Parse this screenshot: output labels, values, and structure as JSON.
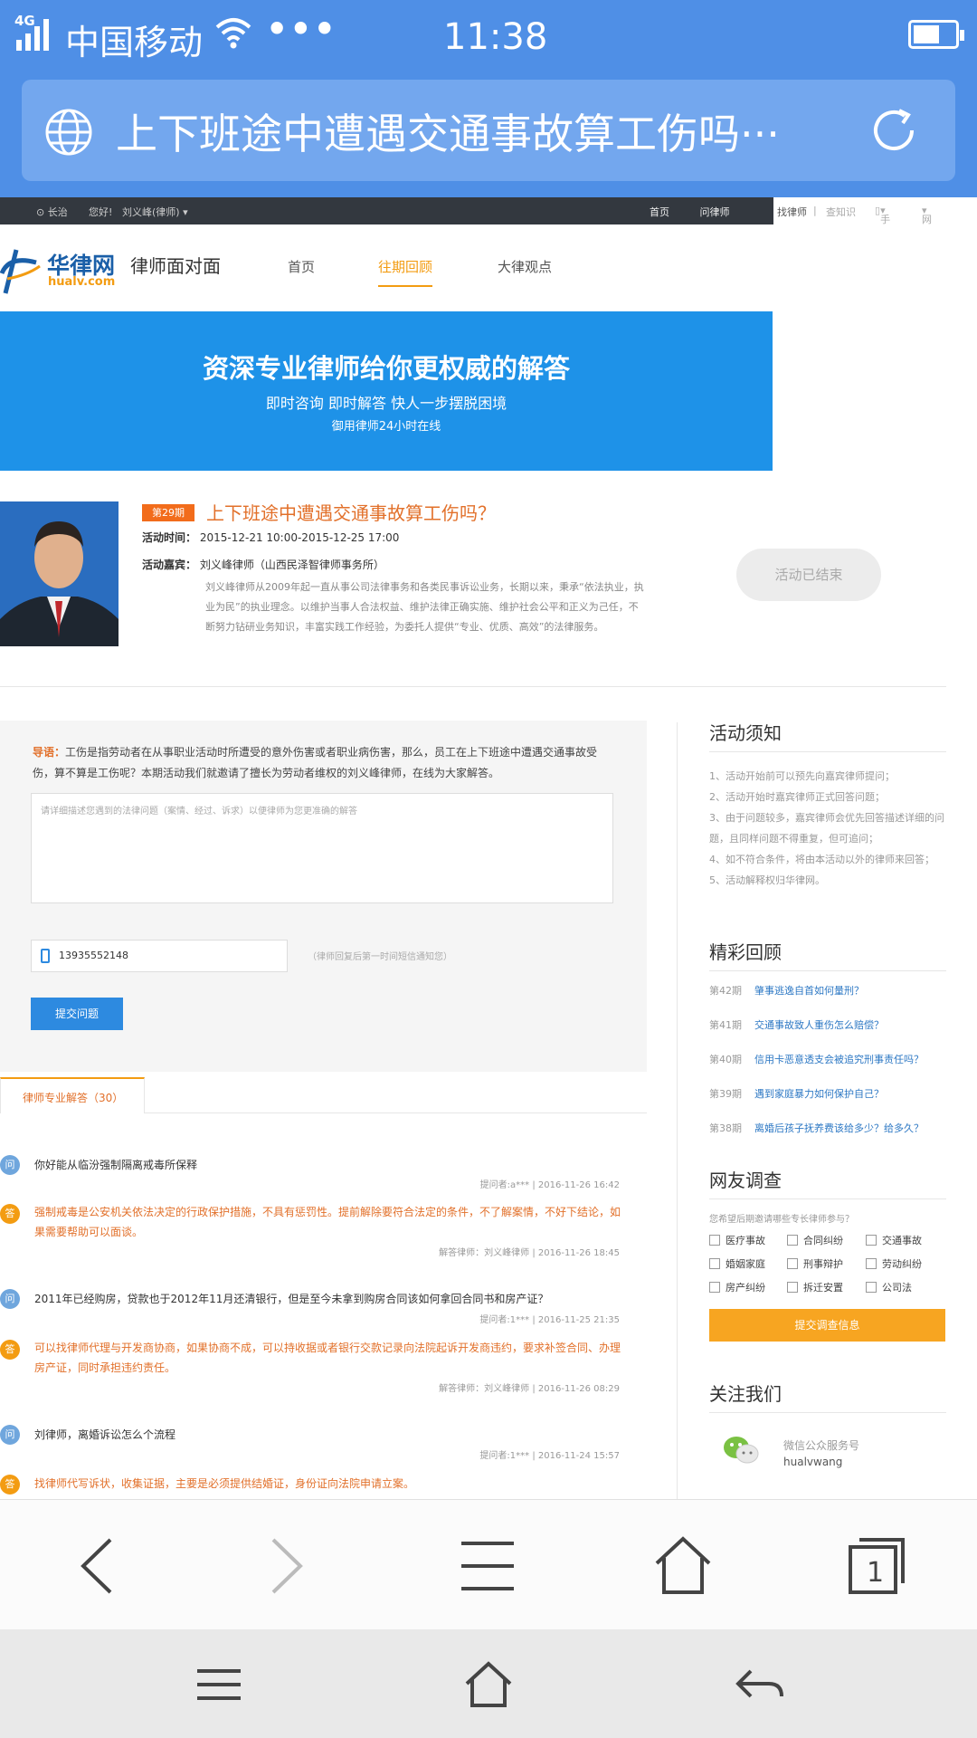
{
  "status": {
    "network": "4G",
    "carrier": "中国移动",
    "dots": "•••",
    "time": "11:38"
  },
  "browser": {
    "title": "上下班途中遭遇交通事故算工伤吗···",
    "tab_count": "1"
  },
  "topbar": {
    "location": "长治",
    "greeting": "您好!",
    "user": "刘义峰(律师)",
    "nav": [
      "首页",
      "问律师",
      "找律师"
    ],
    "right_items": [
      "查知识",
      "手机华律",
      "网站导航"
    ]
  },
  "site": {
    "logo_cn": "华律网",
    "logo_en": "hualv.com",
    "subtitle": "律师面对面",
    "nav": [
      "首页",
      "往期回顾",
      "大律观点"
    ]
  },
  "banner": {
    "title": "资深专业律师给你更权威的解答",
    "line2": "即时咨询 即时解答 快人一步摆脱困境",
    "line3": "御用律师24小时在线"
  },
  "event": {
    "badge": "第29期",
    "title": "上下班途中遭遇交通事故算工伤吗？",
    "time_label": "活动时间：",
    "time_value": "2015-12-21 10:00-2015-12-25 17:00",
    "guest_label": "活动嘉宾：",
    "guest_value": "刘义峰律师（山西民泽智律师事务所）",
    "bio": "刘义峰律师从2009年起一直从事公司法律事务和各类民事诉讼业务，长期以来，秉承“依法执业，执业为民”的执业理念。以维护当事人合法权益、维护法律正确实施、维护社会公平和正义为己任，不断努力钻研业务知识，丰富实践工作经验，为委托人提供“专业、优质、高效”的法律服务。",
    "status": "活动已结束"
  },
  "question_form": {
    "intro_label": "导语：",
    "intro_text": "工伤是指劳动者在从事职业活动时所遭受的意外伤害或者职业病伤害，那么，员工在上下班途中遭遇交通事故受伤，算不算是工伤呢？本期活动我们就邀请了擅长为劳动者维权的刘义峰律师，在线为大家解答。",
    "placeholder": "请详细描述您遇到的法律问题（案情、经过、诉求）以便律师为您更准确的解答",
    "phone": "13935552148",
    "phone_hint": "（律师回复后第一时间短信通知您）",
    "submit": "提交问题"
  },
  "answers": {
    "tab": "律师专业解答（30）",
    "items": [
      {
        "q": "你好能从临汾强制隔离戒毒所保释",
        "q_meta": "提问者:a***  |  2016-11-26 16:42",
        "a": "强制戒毒是公安机关依法决定的行政保护措施，不具有惩罚性。提前解除要符合法定的条件，不了解案情，不好下结论，如果需要帮助可以面谈。",
        "a_meta": "解答律师：刘义峰律师  |  2016-11-26 18:45"
      },
      {
        "q": "2011年已经购房，贷款也于2012年11月还清银行，但是至今未拿到购房合同该如何拿回合同书和房产证？",
        "q_meta": "提问者:1***  |  2016-11-25 21:35",
        "a": "可以找律师代理与开发商协商，如果协商不成，可以持收据或者银行交款记录向法院起诉开发商违约，要求补签合同、办理房产证，同时承担违约责任。",
        "a_meta": "解答律师：刘义峰律师  |  2016-11-26 08:29"
      },
      {
        "q": "刘律师，离婚诉讼怎么个流程",
        "q_meta": "提问者:1***  |  2016-11-24 15:57",
        "a": "找律师代写诉状，收集证据，主要是必须提供结婚证，身份证向法院申请立案。",
        "a_meta": ""
      }
    ],
    "q_icon": "问",
    "a_icon": "答"
  },
  "sidebar": {
    "rules_title": "活动须知",
    "rules": [
      "1、活动开始前可以预先向嘉宾律师提问；",
      "2、活动开始时嘉宾律师正式回答问题；",
      "3、由于问题较多，嘉宾律师会优先回答描述详细的问题，且同样问题不得重复，但可追问；",
      "4、如不符合条件，将由本活动以外的律师来回答；",
      "5、活动解释权归华律网。"
    ],
    "review_title": "精彩回顾",
    "reviews": [
      {
        "no": "第42期",
        "title": "肇事逃逸自首如何量刑？"
      },
      {
        "no": "第41期",
        "title": "交通事故致人重伤怎么赔偿？"
      },
      {
        "no": "第40期",
        "title": "信用卡恶意透支会被追究刑事责任吗？"
      },
      {
        "no": "第39期",
        "title": "遇到家庭暴力如何保护自己？"
      },
      {
        "no": "第38期",
        "title": "离婚后孩子抚养费该给多少？给多久？"
      }
    ],
    "survey_title": "网友调查",
    "survey_question": "您希望后期邀请哪些专长律师参与？",
    "survey_options": [
      "医疗事故",
      "合同纠纷",
      "交通事故",
      "婚姻家庭",
      "刑事辩护",
      "劳动纠纷",
      "房产纠纷",
      "拆迁安置",
      "公司法"
    ],
    "survey_submit": "提交调查信息",
    "follow_title": "关注我们",
    "follow_text": "微信公众服务号",
    "follow_id": "hualvwang"
  },
  "colors": {
    "accent": "#f39c12",
    "brand_blue": "#4f8fe6",
    "link": "#2d78c4"
  }
}
